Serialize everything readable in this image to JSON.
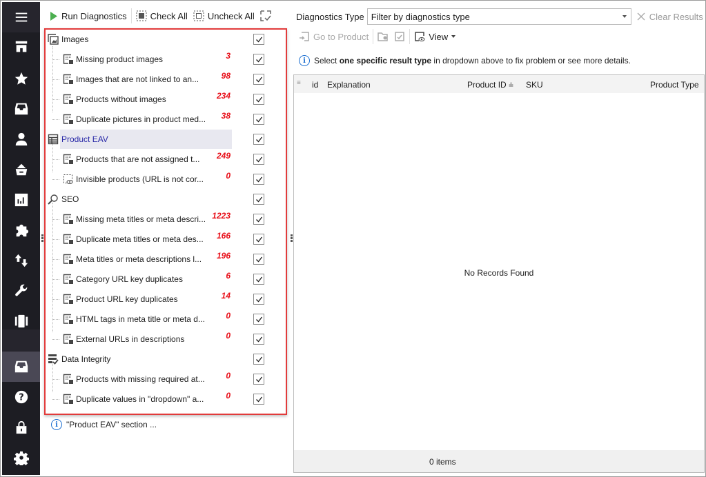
{
  "sidebar": {
    "items": [
      {
        "icon": "menu-icon"
      },
      {
        "icon": "store-icon"
      },
      {
        "icon": "star-icon"
      },
      {
        "icon": "inbox-icon"
      },
      {
        "icon": "user-icon"
      },
      {
        "icon": "basket-icon"
      },
      {
        "icon": "chart-icon"
      },
      {
        "icon": "puzzle-icon"
      },
      {
        "icon": "import-export-icon"
      },
      {
        "icon": "wrench-icon"
      },
      {
        "icon": "carousel-icon"
      },
      {
        "icon": "diagnostics-inbox-icon",
        "active": true
      },
      {
        "icon": "help-icon"
      },
      {
        "icon": "lock-icon"
      },
      {
        "icon": "gear-icon"
      }
    ]
  },
  "toolbar": {
    "run": "Run Diagnostics",
    "check_all": "Check All",
    "uncheck_all": "Uncheck All"
  },
  "tree": [
    {
      "type": "cat",
      "label": "Images",
      "checked": true
    },
    {
      "type": "child",
      "label": "Missing product images",
      "count": "3",
      "checked": true
    },
    {
      "type": "child",
      "label": "Images that are not linked to an...",
      "count": "98",
      "checked": true
    },
    {
      "type": "child",
      "label": "Products without images",
      "count": "234",
      "checked": true
    },
    {
      "type": "child",
      "label": "Duplicate pictures in product med...",
      "count": "38",
      "checked": true
    },
    {
      "type": "cat",
      "label": "Product  EAV",
      "checked": true,
      "selected": true
    },
    {
      "type": "child",
      "label": "Products that are not assigned t...",
      "count": "249",
      "checked": true
    },
    {
      "type": "child",
      "label": "Invisible products (URL is not cor...",
      "count": "0",
      "checked": true
    },
    {
      "type": "cat",
      "label": "SEO",
      "checked": true
    },
    {
      "type": "child",
      "label": "Missing meta titles or meta descri...",
      "count": "1223",
      "checked": true
    },
    {
      "type": "child",
      "label": "Duplicate meta titles or meta des...",
      "count": "166",
      "checked": true
    },
    {
      "type": "child",
      "label": "Meta titles or meta descriptions l...",
      "count": "196",
      "checked": true
    },
    {
      "type": "child",
      "label": "Category URL key duplicates",
      "count": "6",
      "checked": true
    },
    {
      "type": "child",
      "label": "Product URL key duplicates",
      "count": "14",
      "checked": true
    },
    {
      "type": "child",
      "label": "HTML tags in meta title or meta d...",
      "count": "0",
      "checked": true
    },
    {
      "type": "child",
      "label": "External URLs in descriptions",
      "count": "0",
      "checked": true
    },
    {
      "type": "cat",
      "label": "Data Integrity",
      "checked": true
    },
    {
      "type": "child",
      "label": "Products with missing required at...",
      "count": "0",
      "checked": true
    },
    {
      "type": "child",
      "label": "Duplicate values in \"dropdown\" a...",
      "count": "0",
      "checked": true
    }
  ],
  "note": "\"Product  EAV\" section ...",
  "right": {
    "diag_label": "Diagnostics Type",
    "filter_value": "Filter by diagnostics type",
    "clear": "Clear Results",
    "go_to_product": "Go to Product",
    "view": "View",
    "hint_pre": "Select ",
    "hint_bold": "one specific result type",
    "hint_post": " in dropdown above to fix problem or see more details.",
    "columns": [
      "id",
      "Explanation",
      "Product ID",
      "SKU",
      "Product Type"
    ],
    "empty": "No Records Found",
    "footer": "0 items"
  },
  "colors": {
    "highlight_border": "#e23b3b",
    "count_red": "#e8101a",
    "category_selected": "#2a2aa8",
    "sidebar_bg": "#1d1d23"
  }
}
